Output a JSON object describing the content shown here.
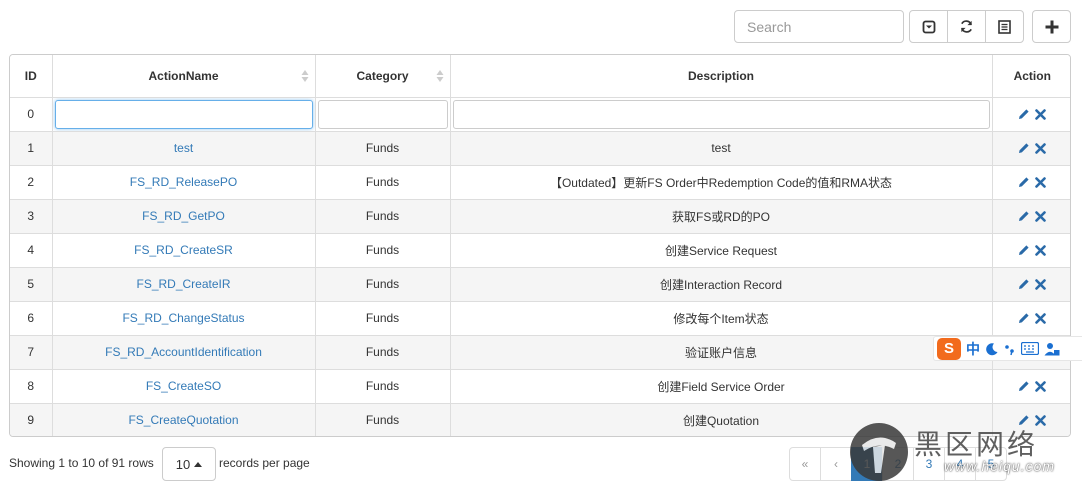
{
  "toolbar": {
    "search_placeholder": "Search",
    "buttons": [
      "toggle-pagination",
      "refresh",
      "columns"
    ],
    "add_button": "add"
  },
  "table": {
    "columns": [
      "ID",
      "ActionName",
      "Category",
      "Description",
      "Action"
    ],
    "filter_row_id": "0",
    "rows": [
      {
        "id": "1",
        "name": "test",
        "category": "Funds",
        "description": "test"
      },
      {
        "id": "2",
        "name": "FS_RD_ReleasePO",
        "category": "Funds",
        "description": "【Outdated】更新FS Order中Redemption Code的值和RMA状态"
      },
      {
        "id": "3",
        "name": "FS_RD_GetPO",
        "category": "Funds",
        "description": "获取FS或RD的PO"
      },
      {
        "id": "4",
        "name": "FS_RD_CreateSR",
        "category": "Funds",
        "description": "创建Service Request"
      },
      {
        "id": "5",
        "name": "FS_RD_CreateIR",
        "category": "Funds",
        "description": "创建Interaction Record"
      },
      {
        "id": "6",
        "name": "FS_RD_ChangeStatus",
        "category": "Funds",
        "description": "修改每个Item状态"
      },
      {
        "id": "7",
        "name": "FS_RD_AccountIdentification",
        "category": "Funds",
        "description": "验证账户信息"
      },
      {
        "id": "8",
        "name": "FS_CreateSO",
        "category": "Funds",
        "description": "创建Field Service Order"
      },
      {
        "id": "9",
        "name": "FS_CreateQuotation",
        "category": "Funds",
        "description": "创建Quotation"
      }
    ],
    "link_color": "#337ab7",
    "action_icon_color": "#2a6aa8"
  },
  "footer": {
    "showing": "Showing 1 to 10 of 91 rows",
    "page_size": "10",
    "records_per_page": "records per page"
  },
  "pagination": {
    "first": "«",
    "prev": "‹",
    "pages": [
      "1",
      "2",
      "3",
      "4",
      "5"
    ],
    "active": "1",
    "active_color": "#337ab7"
  },
  "ime": {
    "logo": "S",
    "mode": "中"
  },
  "watermark": {
    "big": "黑区网络",
    "small": "www.heiqu.com"
  }
}
